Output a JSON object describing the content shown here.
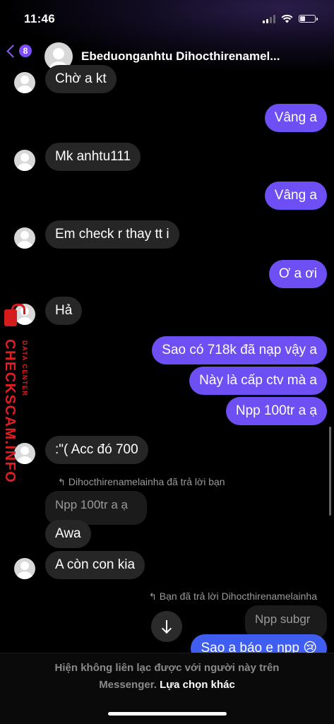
{
  "status_bar": {
    "time": "11:46"
  },
  "header": {
    "back_badge_count": "8",
    "contact_name": "Ebeduonganhtu Dihocthirenamel..."
  },
  "messages": [
    {
      "side": "in",
      "text": "Chờ a kt"
    },
    {
      "side": "out",
      "text": "Vâng a"
    },
    {
      "side": "in",
      "text": "Mk anhtu111"
    },
    {
      "side": "out",
      "text": "Vâng a"
    },
    {
      "side": "in",
      "text": "Em check r thay tt i"
    },
    {
      "side": "out",
      "text": "Ơ a ơi"
    },
    {
      "side": "in",
      "text": "Hả"
    },
    {
      "side": "out",
      "text": "Sao có 718k đã nạp vậy a"
    },
    {
      "side": "out",
      "text": "Này là cấp ctv mà a"
    },
    {
      "side": "out",
      "text": "Npp 100tr a ạ"
    },
    {
      "side": "in",
      "text": ":\"( Acc đó 700"
    },
    {
      "side": "in",
      "text": "Awa"
    },
    {
      "side": "in",
      "text": "A còn con kia"
    },
    {
      "side": "out",
      "text": "Sao a báo e npp 😢"
    }
  ],
  "replies": {
    "reply1_note": "Dihocthirenamelainha đã trả lời bạn",
    "reply1_quote": "Npp 100tr a ạ",
    "reply2_note": "Bạn đã trả lời Dihocthirenamelainha",
    "reply2_quote": "Npp subgr"
  },
  "footer": {
    "notice_line1": "Hiện không liên lạc được với người này trên",
    "notice_line2": "Messenger.",
    "link": "Lựa chọn khác"
  },
  "watermark": {
    "main": "CHECKSCAM.INFO",
    "sub": "DATA CENTER"
  },
  "colors": {
    "outgoing": "#6d4ff4",
    "outgoing_bottom": "#3f5ef0",
    "incoming": "#262626",
    "accent": "#7b4dff",
    "watermark": "#e02020"
  }
}
